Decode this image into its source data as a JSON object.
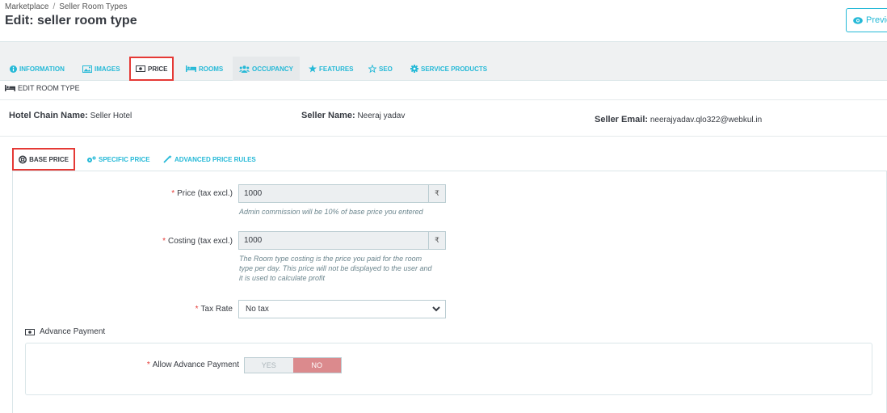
{
  "breadcrumb": {
    "root": "Marketplace",
    "separator": "/",
    "current": "Seller Room Types"
  },
  "page_title": "Edit: seller room type",
  "preview_button": "Previe",
  "tabs": [
    {
      "label": "INFORMATION",
      "icon": "info-circle-icon"
    },
    {
      "label": "IMAGES",
      "icon": "image-icon"
    },
    {
      "label": "PRICE",
      "icon": "money-icon",
      "active": true
    },
    {
      "label": "ROOMS",
      "icon": "bed-icon"
    },
    {
      "label": "OCCUPANCY",
      "icon": "users-icon"
    },
    {
      "label": "FEATURES",
      "icon": "star-icon"
    },
    {
      "label": "SEO",
      "icon": "star-outline-icon"
    },
    {
      "label": "SERVICE PRODUCTS",
      "icon": "gear-icon"
    }
  ],
  "section_heading": "EDIT ROOM TYPE",
  "seller_info": {
    "hotel_chain_label": "Hotel Chain Name:",
    "hotel_chain_value": "Seller Hotel",
    "seller_name_label": "Seller Name:",
    "seller_name_value": "Neeraj yadav",
    "seller_email_label": "Seller Email:",
    "seller_email_value": "neerajyadav.qlo322@webkul.in"
  },
  "subtabs": [
    {
      "label": "BASE PRICE",
      "icon": "life-ring-icon",
      "active": true
    },
    {
      "label": "SPECIFIC PRICE",
      "icon": "gears-icon"
    },
    {
      "label": "ADVANCED PRICE RULES",
      "icon": "magic-wand-icon"
    }
  ],
  "form": {
    "required_mark": "*",
    "price_label": "Price (tax excl.)",
    "price_value": "1000",
    "currency_symbol": "₹",
    "price_help": "Admin commission will be 10% of base price you entered",
    "costing_label": "Costing (tax excl.)",
    "costing_value": "1000",
    "costing_help_1": "The Room type costing is the price you paid for the room",
    "costing_help_2": "type per day. This price will not be displayed to the user and",
    "costing_help_3": "it is used to calculate profit",
    "tax_label": "Tax Rate",
    "tax_value": "No tax"
  },
  "advance_payment": {
    "title": "Advance Payment",
    "allow_label": "Allow Advance Payment",
    "yes": "YES",
    "no": "NO",
    "selected": "NO"
  },
  "colors": {
    "accent": "#25b9d7",
    "highlight_border": "#e53935",
    "toggle_no": "#db8a8d"
  }
}
